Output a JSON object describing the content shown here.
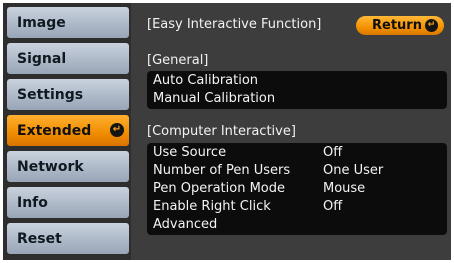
{
  "menu": {
    "items": [
      {
        "label": "Image"
      },
      {
        "label": "Signal"
      },
      {
        "label": "Settings"
      },
      {
        "label": "Extended",
        "active": true
      },
      {
        "label": "Network"
      },
      {
        "label": "Info"
      },
      {
        "label": "Reset"
      }
    ],
    "active_icon": "enter-icon"
  },
  "panel": {
    "title": "[Easy Interactive Function]",
    "return_label": "Return",
    "return_icon": "enter-icon",
    "general": {
      "heading": "[General]",
      "items": [
        {
          "label": "Auto Calibration"
        },
        {
          "label": "Manual Calibration"
        }
      ]
    },
    "computer_interactive": {
      "heading": "[Computer Interactive]",
      "items": [
        {
          "label": "Use Source",
          "value": "Off"
        },
        {
          "label": "Number of Pen Users",
          "value": "One User"
        },
        {
          "label": "Pen Operation Mode",
          "value": "Mouse"
        },
        {
          "label": "Enable Right Click",
          "value": "Off"
        },
        {
          "label": "Advanced",
          "value": ""
        }
      ]
    }
  },
  "colors": {
    "accent": "#f39200",
    "menu_item": "#aeb9c8",
    "panel_bg": "#3d3d3d",
    "group_bg": "#0c0c0c"
  }
}
